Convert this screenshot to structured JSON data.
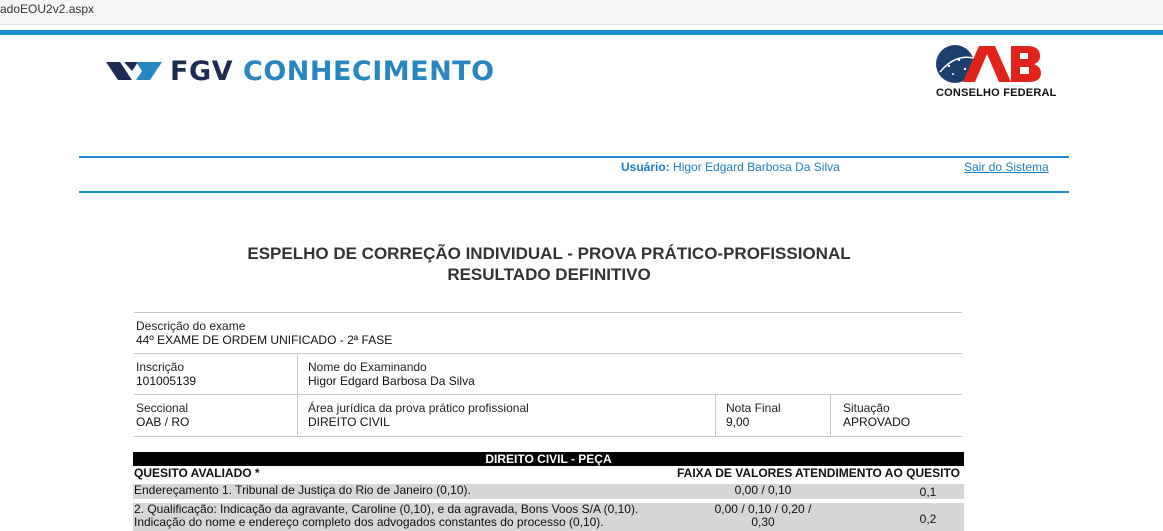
{
  "browser": {
    "url": "adoEOU2v2.aspx"
  },
  "header": {
    "brand_part1": "FGV",
    "brand_part2": "CONHECIMENTO",
    "oab_caption": "CONSELHO FEDERAL",
    "colors": {
      "accent": "#1a8fd0",
      "fgv_dark": "#1e2c54",
      "fgv_blue": "#2a86c0",
      "oab_red": "#e2231a"
    }
  },
  "session": {
    "user_label": "Usuário:",
    "user_name": "Higor Edgard Barbosa Da Silva",
    "logout": "Sair do Sistema"
  },
  "title": {
    "line1": "ESPELHO DE CORREÇÃO INDIVIDUAL - PROVA PRÁTICO-PROFISSIONAL",
    "line2": "RESULTADO DEFINITIVO"
  },
  "exam": {
    "description_label": "Descrição do exame",
    "description_value": "44º EXAME DE ORDEM UNIFICADO - 2ª FASE",
    "registration_label": "Inscrição",
    "registration_value": "101005139",
    "name_label": "Nome do Examinando",
    "name_value": "Higor Edgard Barbosa Da Silva",
    "section_label": "Seccional",
    "section_value": "OAB / RO",
    "area_label": "Área jurídica da prova prático profissional",
    "area_value": "DIREITO CIVIL",
    "final_grade_label": "Nota Final",
    "final_grade_value": "9,00",
    "status_label": "Situação",
    "status_value": "APROVADO"
  },
  "grading": {
    "section_title": "DIREITO CIVIL - PEÇA",
    "col_item": "QUESITO AVALIADO *",
    "col_range": "FAIXA DE VALORES",
    "col_score": "ATENDIMENTO AO QUESITO",
    "rows": [
      {
        "desc_lines": [
          "Endereçamento 1. Tribunal de Justiça do Rio de Janeiro (0,10)."
        ],
        "range_lines": [
          "0,00 / 0,10"
        ],
        "score": "0,1"
      },
      {
        "desc_lines": [
          "2. Qualificação: Indicação da agravante, Caroline (0,10), e da agravada, Bons Voos S/A (0,10).",
          "Indicação do nome e endereço completo dos advogados constantes do processo (0,10)."
        ],
        "range_lines": [
          "0,00 / 0,10 / 0,20 /",
          "0,30"
        ],
        "score": "0,2"
      }
    ]
  }
}
